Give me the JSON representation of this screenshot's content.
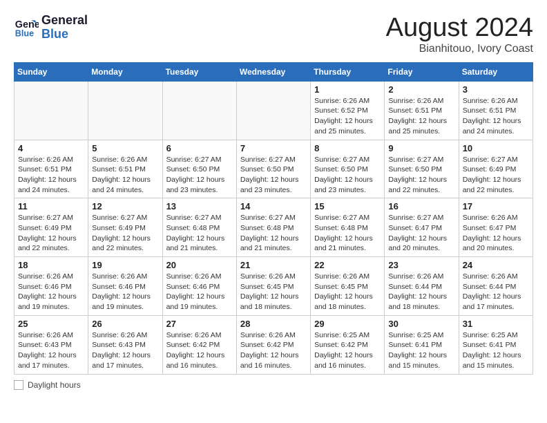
{
  "header": {
    "logo_line1": "General",
    "logo_line2": "Blue",
    "main_title": "August 2024",
    "sub_title": "Bianhitouo, Ivory Coast"
  },
  "days_of_week": [
    "Sunday",
    "Monday",
    "Tuesday",
    "Wednesday",
    "Thursday",
    "Friday",
    "Saturday"
  ],
  "footer": {
    "label": "Daylight hours"
  },
  "weeks": [
    [
      {
        "day": "",
        "info": ""
      },
      {
        "day": "",
        "info": ""
      },
      {
        "day": "",
        "info": ""
      },
      {
        "day": "",
        "info": ""
      },
      {
        "day": "1",
        "info": "Sunrise: 6:26 AM\nSunset: 6:52 PM\nDaylight: 12 hours\nand 25 minutes."
      },
      {
        "day": "2",
        "info": "Sunrise: 6:26 AM\nSunset: 6:51 PM\nDaylight: 12 hours\nand 25 minutes."
      },
      {
        "day": "3",
        "info": "Sunrise: 6:26 AM\nSunset: 6:51 PM\nDaylight: 12 hours\nand 24 minutes."
      }
    ],
    [
      {
        "day": "4",
        "info": "Sunrise: 6:26 AM\nSunset: 6:51 PM\nDaylight: 12 hours\nand 24 minutes."
      },
      {
        "day": "5",
        "info": "Sunrise: 6:26 AM\nSunset: 6:51 PM\nDaylight: 12 hours\nand 24 minutes."
      },
      {
        "day": "6",
        "info": "Sunrise: 6:27 AM\nSunset: 6:50 PM\nDaylight: 12 hours\nand 23 minutes."
      },
      {
        "day": "7",
        "info": "Sunrise: 6:27 AM\nSunset: 6:50 PM\nDaylight: 12 hours\nand 23 minutes."
      },
      {
        "day": "8",
        "info": "Sunrise: 6:27 AM\nSunset: 6:50 PM\nDaylight: 12 hours\nand 23 minutes."
      },
      {
        "day": "9",
        "info": "Sunrise: 6:27 AM\nSunset: 6:50 PM\nDaylight: 12 hours\nand 22 minutes."
      },
      {
        "day": "10",
        "info": "Sunrise: 6:27 AM\nSunset: 6:49 PM\nDaylight: 12 hours\nand 22 minutes."
      }
    ],
    [
      {
        "day": "11",
        "info": "Sunrise: 6:27 AM\nSunset: 6:49 PM\nDaylight: 12 hours\nand 22 minutes."
      },
      {
        "day": "12",
        "info": "Sunrise: 6:27 AM\nSunset: 6:49 PM\nDaylight: 12 hours\nand 22 minutes."
      },
      {
        "day": "13",
        "info": "Sunrise: 6:27 AM\nSunset: 6:48 PM\nDaylight: 12 hours\nand 21 minutes."
      },
      {
        "day": "14",
        "info": "Sunrise: 6:27 AM\nSunset: 6:48 PM\nDaylight: 12 hours\nand 21 minutes."
      },
      {
        "day": "15",
        "info": "Sunrise: 6:27 AM\nSunset: 6:48 PM\nDaylight: 12 hours\nand 21 minutes."
      },
      {
        "day": "16",
        "info": "Sunrise: 6:27 AM\nSunset: 6:47 PM\nDaylight: 12 hours\nand 20 minutes."
      },
      {
        "day": "17",
        "info": "Sunrise: 6:26 AM\nSunset: 6:47 PM\nDaylight: 12 hours\nand 20 minutes."
      }
    ],
    [
      {
        "day": "18",
        "info": "Sunrise: 6:26 AM\nSunset: 6:46 PM\nDaylight: 12 hours\nand 19 minutes."
      },
      {
        "day": "19",
        "info": "Sunrise: 6:26 AM\nSunset: 6:46 PM\nDaylight: 12 hours\nand 19 minutes."
      },
      {
        "day": "20",
        "info": "Sunrise: 6:26 AM\nSunset: 6:46 PM\nDaylight: 12 hours\nand 19 minutes."
      },
      {
        "day": "21",
        "info": "Sunrise: 6:26 AM\nSunset: 6:45 PM\nDaylight: 12 hours\nand 18 minutes."
      },
      {
        "day": "22",
        "info": "Sunrise: 6:26 AM\nSunset: 6:45 PM\nDaylight: 12 hours\nand 18 minutes."
      },
      {
        "day": "23",
        "info": "Sunrise: 6:26 AM\nSunset: 6:44 PM\nDaylight: 12 hours\nand 18 minutes."
      },
      {
        "day": "24",
        "info": "Sunrise: 6:26 AM\nSunset: 6:44 PM\nDaylight: 12 hours\nand 17 minutes."
      }
    ],
    [
      {
        "day": "25",
        "info": "Sunrise: 6:26 AM\nSunset: 6:43 PM\nDaylight: 12 hours\nand 17 minutes."
      },
      {
        "day": "26",
        "info": "Sunrise: 6:26 AM\nSunset: 6:43 PM\nDaylight: 12 hours\nand 17 minutes."
      },
      {
        "day": "27",
        "info": "Sunrise: 6:26 AM\nSunset: 6:42 PM\nDaylight: 12 hours\nand 16 minutes."
      },
      {
        "day": "28",
        "info": "Sunrise: 6:26 AM\nSunset: 6:42 PM\nDaylight: 12 hours\nand 16 minutes."
      },
      {
        "day": "29",
        "info": "Sunrise: 6:25 AM\nSunset: 6:42 PM\nDaylight: 12 hours\nand 16 minutes."
      },
      {
        "day": "30",
        "info": "Sunrise: 6:25 AM\nSunset: 6:41 PM\nDaylight: 12 hours\nand 15 minutes."
      },
      {
        "day": "31",
        "info": "Sunrise: 6:25 AM\nSunset: 6:41 PM\nDaylight: 12 hours\nand 15 minutes."
      }
    ]
  ]
}
